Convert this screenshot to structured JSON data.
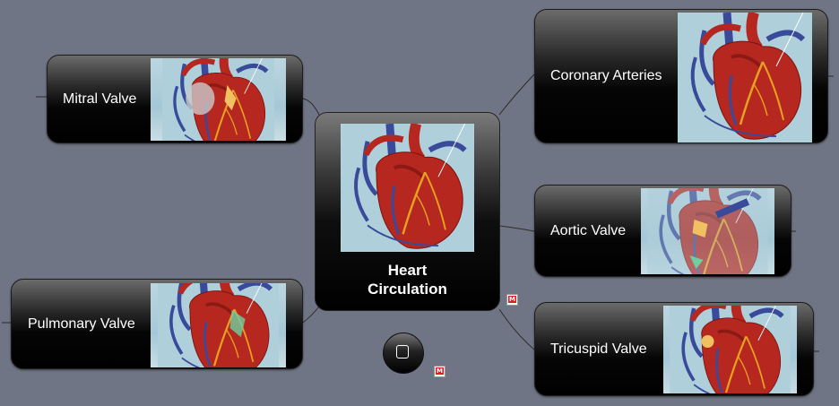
{
  "center": {
    "title_line1": "Heart",
    "title_line2": "Circulation"
  },
  "nodes": {
    "mitral": {
      "label": "Mitral Valve"
    },
    "pulmonary": {
      "label": "Pulmonary Valve"
    },
    "coronary": {
      "label": "Coronary Arteries"
    },
    "aortic": {
      "label": "Aortic Valve"
    },
    "tricuspid": {
      "label": "Tricuspid Valve"
    }
  },
  "icons": {
    "center_control": "square-icon",
    "attachment": "mindmap-file-icon",
    "attachment_glyph": "M"
  },
  "colors": {
    "background": "#6f7584",
    "node_dark": "#000000",
    "heart_red": "#b5271f",
    "artery_orange": "#e8a020"
  }
}
